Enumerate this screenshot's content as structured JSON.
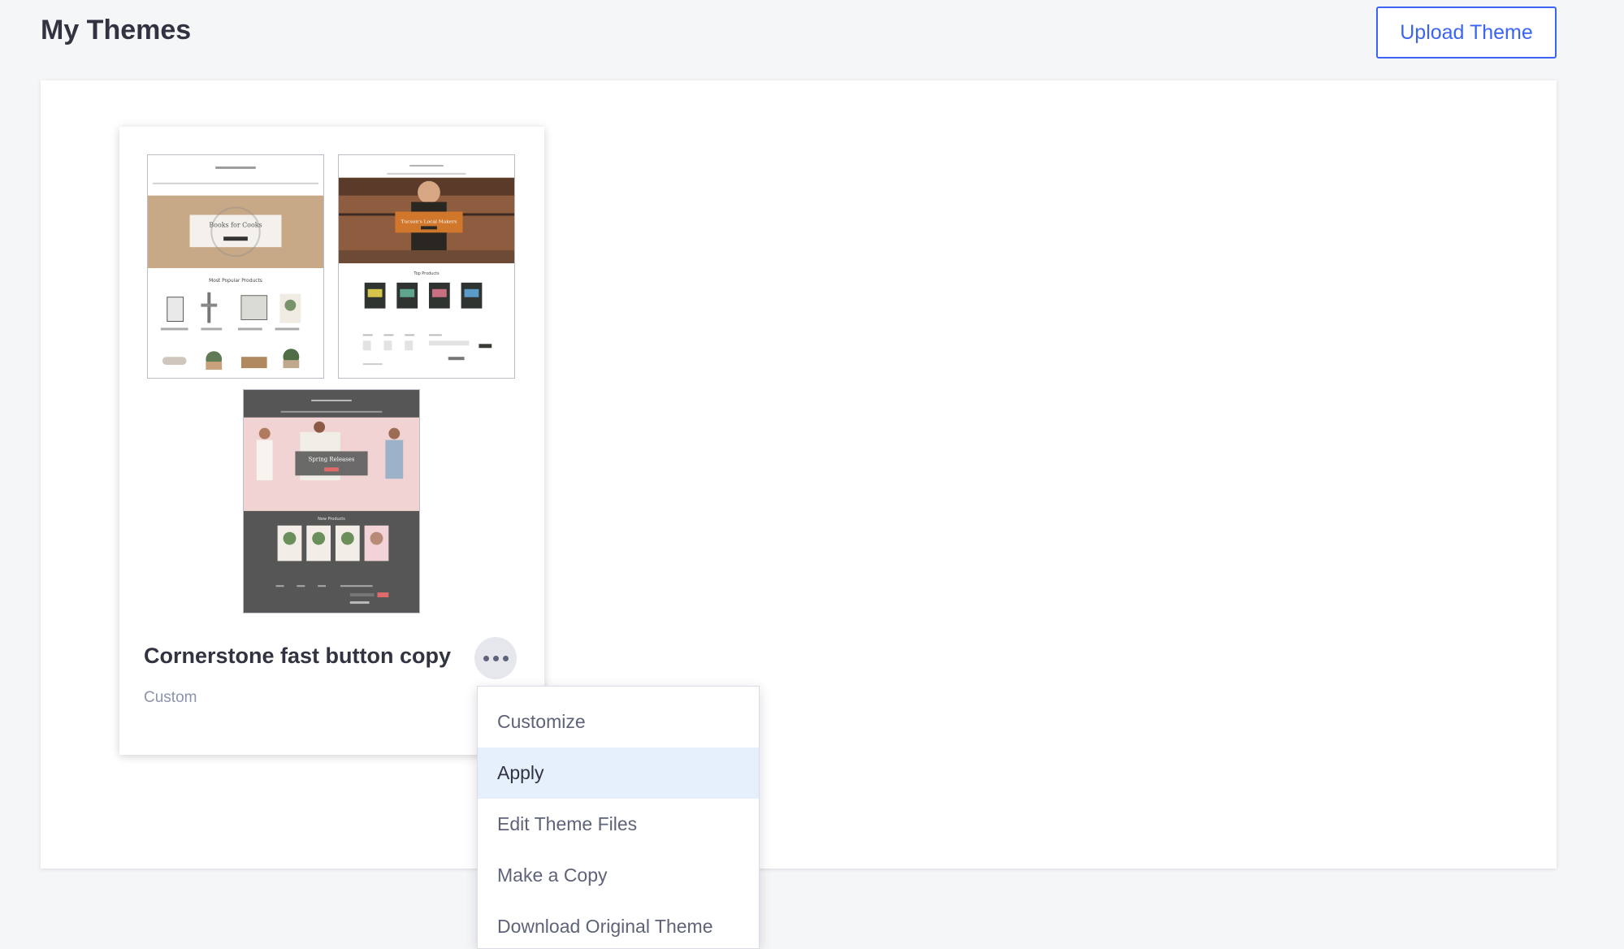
{
  "header": {
    "title": "My Themes",
    "upload_button": "Upload Theme"
  },
  "theme_card": {
    "name": "Cornerstone fast button copy",
    "type": "Custom",
    "previews": [
      {
        "variation": "light",
        "hero_text": "Books for Cooks",
        "section_title": "Most Popular Products"
      },
      {
        "variation": "bold",
        "hero_text": "Tucson's Local Makers",
        "section_title": "Top Products"
      },
      {
        "variation": "warm",
        "hero_text": "Spring Releases",
        "section_title": "New Products"
      }
    ]
  },
  "dropdown": {
    "items": [
      {
        "label": "Customize",
        "active": false
      },
      {
        "label": "Apply",
        "active": true
      },
      {
        "label": "Edit Theme Files",
        "active": false
      },
      {
        "label": "Make a Copy",
        "active": false
      },
      {
        "label": "Download Original Theme",
        "active": false
      }
    ]
  },
  "colors": {
    "primary": "#3c64f4",
    "active_bg": "#e5f0fc",
    "page_bg": "#f5f6f8",
    "text_dark": "#313440",
    "text_muted": "#8c93ad"
  }
}
